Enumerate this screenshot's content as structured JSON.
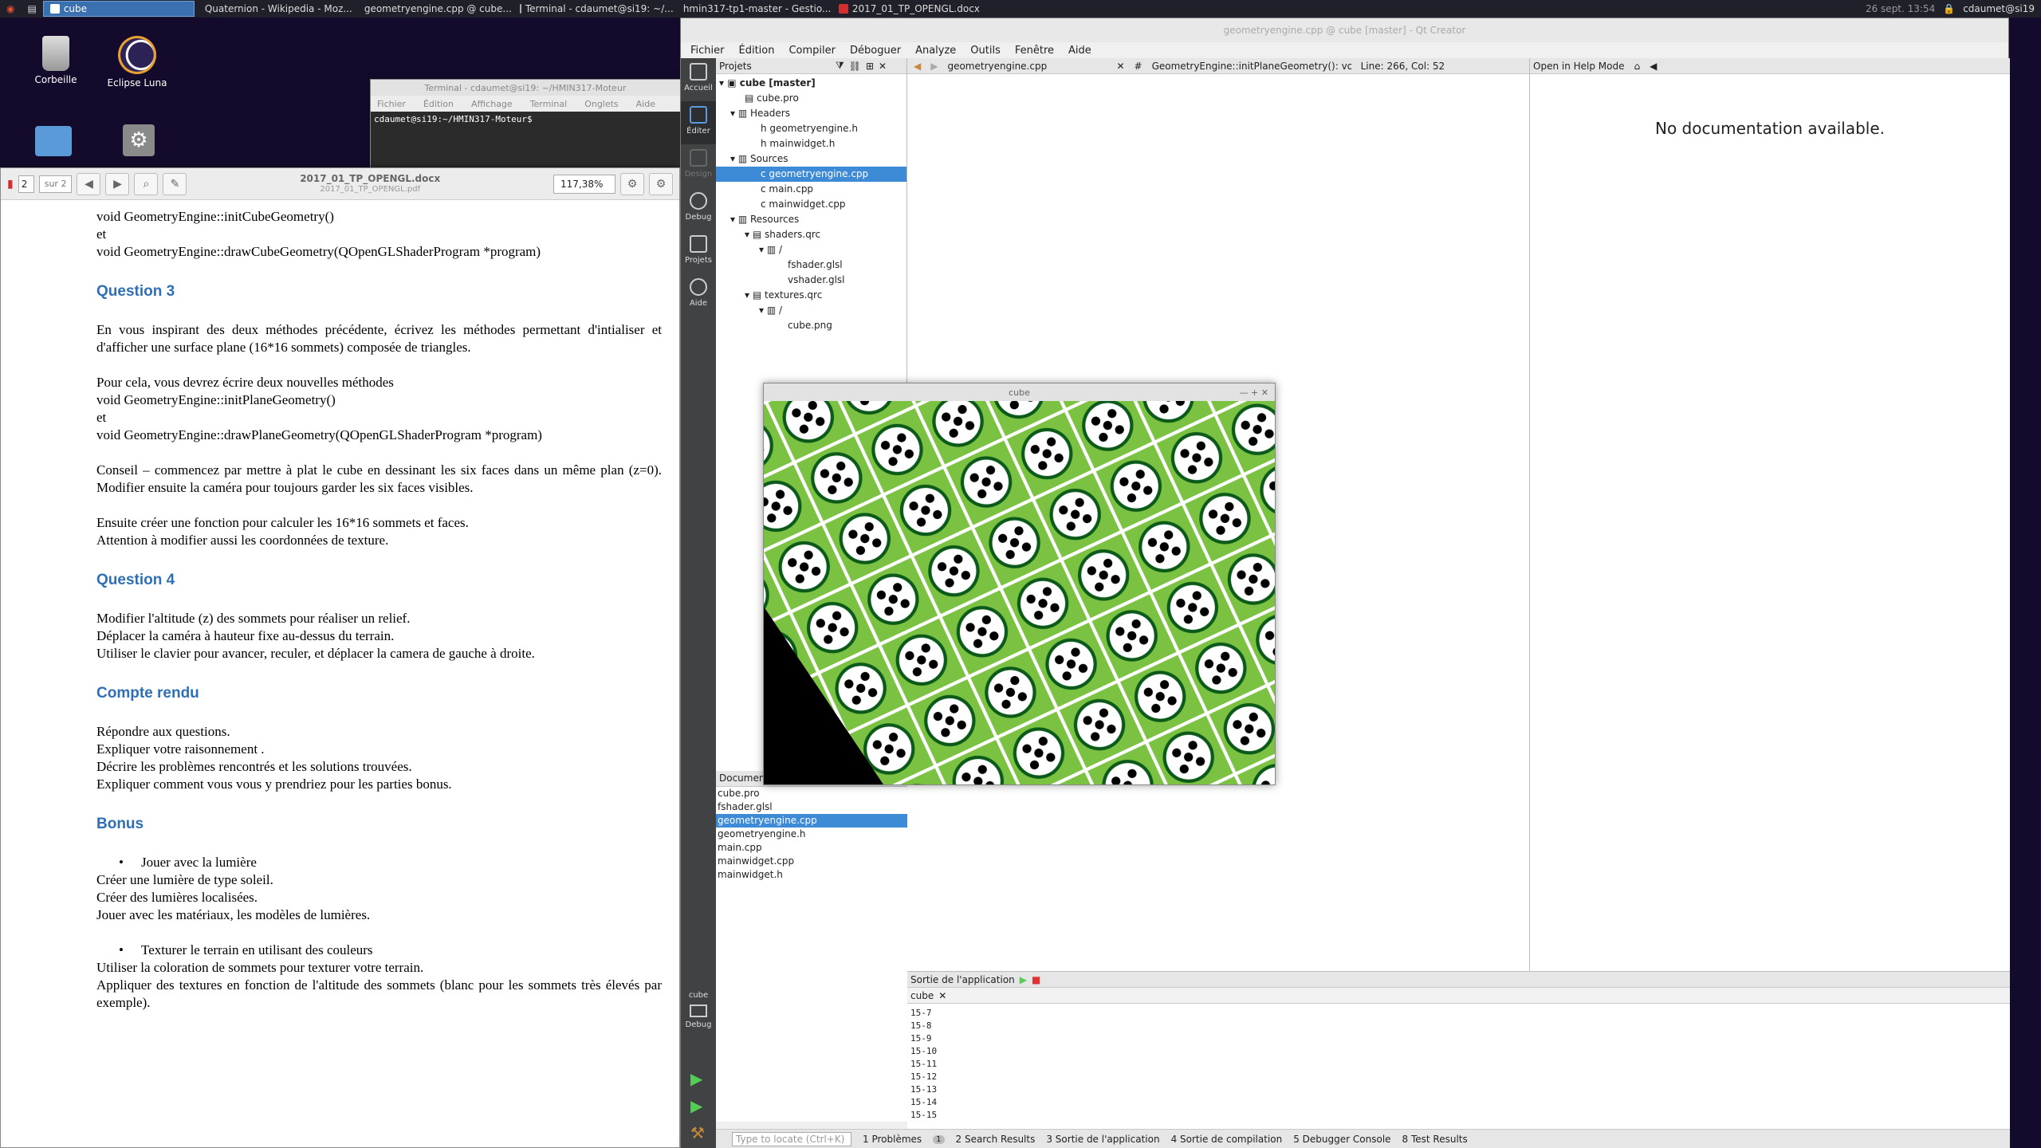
{
  "taskbar": {
    "items": [
      {
        "label": "cube",
        "active": true
      },
      {
        "label": "Quaternion - Wikipedia - Moz..."
      },
      {
        "label": "geometryengine.cpp @ cube..."
      },
      {
        "label": "Terminal - cdaumet@si19: ~/..."
      },
      {
        "label": "hmin317-tp1-master - Gestio..."
      },
      {
        "label": "2017_01_TP_OPENGL.docx"
      }
    ],
    "clock": "26 sept. 13:54",
    "user": "cdaumet@si19"
  },
  "desktop": {
    "icons": [
      {
        "label": "Corbeille"
      },
      {
        "label": "Eclipse Luna"
      }
    ]
  },
  "terminal": {
    "title": "Terminal - cdaumet@si19: ~/HMIN317-Moteur",
    "menu": [
      "Fichier",
      "Édition",
      "Affichage",
      "Terminal",
      "Onglets",
      "Aide"
    ],
    "prompt": "cdaumet@si19:~/HMIN317-Moteur$ "
  },
  "docviewer": {
    "page": "2",
    "of": "sur 2",
    "title": "2017_01_TP_OPENGL.docx",
    "subtitle": "2017_01_TP_OPENGL.pdf",
    "zoom": "117,38%",
    "lines": {
      "l1": "void GeometryEngine::initCubeGeometry()",
      "l2": "et",
      "l3": "void GeometryEngine::drawCubeGeometry(QOpenGLShaderProgram *program)",
      "h3": "Question 3",
      "q3p1": "En vous inspirant des deux méthodes précédente, écrivez les méthodes permettant d'intialiser et d'afficher une surface plane (16*16 sommets) composée de triangles.",
      "q3p2a": "Pour cela, vous devrez écrire deux nouvelles méthodes",
      "q3p2b": "void GeometryEngine::initPlaneGeometry()",
      "q3p2c": "et",
      "q3p2d": "void GeometryEngine::drawPlaneGeometry(QOpenGLShaderProgram *program)",
      "q3p3": "Conseil – commencez par mettre à plat le cube en dessinant les six faces dans un même plan (z=0). Modifier ensuite la caméra pour toujours garder les six faces visibles.",
      "q3p4a": "Ensuite créer une fonction pour calculer les  16*16 sommets et faces.",
      "q3p4b": "Attention à modifier aussi les coordonnées de texture.",
      "h4": "Question 4",
      "q4a": "Modifier l'altitude (z) des sommets pour réaliser un relief.",
      "q4b": "Déplacer la caméra à hauteur fixe au-dessus du terrain.",
      "q4c": "Utiliser le clavier pour avancer, reculer, et déplacer la camera de gauche à droite.",
      "hcr": "Compte rendu",
      "cra": "Répondre aux questions.",
      "crb": "Expliquer votre raisonnement .",
      "crc": "Décrire les problèmes rencontrés et les solutions trouvées.",
      "crd": "Expliquer comment vous vous y prendriez pour les parties bonus.",
      "hb": "Bonus",
      "b1": "Jouer avec la lumière",
      "b1a": "Créer une lumière de type soleil.",
      "b1b": "Créer des lumières localisées.",
      "b1c": "Jouer avec les matériaux, les modèles de lumières.",
      "b2": "Texturer le terrain en utilisant des couleurs",
      "b2a": "Utiliser la coloration de sommets pour texturer votre terrain.",
      "b2b": "Appliquer des textures en fonction de l'altitude des sommets (blanc pour les sommets très élevés par exemple)."
    }
  },
  "qt": {
    "title": "geometryengine.cpp @ cube [master] - Qt Creator",
    "menu": [
      "Fichier",
      "Édition",
      "Compiler",
      "Déboguer",
      "Analyze",
      "Outils",
      "Fenêtre",
      "Aide"
    ],
    "modes": [
      "Accueil",
      "Éditer",
      "Design",
      "Debug",
      "Projets",
      "Aide"
    ],
    "projects_label": "Projets",
    "tree": [
      "cube [master]",
      "cube.pro",
      "Headers",
      "geometryengine.h",
      "mainwidget.h",
      "Sources",
      "geometryengine.cpp",
      "main.cpp",
      "mainwidget.cpp",
      "Resources",
      "shaders.qrc",
      "/",
      "fshader.glsl",
      "vshader.glsl",
      "textures.qrc",
      "/",
      "cube.png"
    ],
    "opendocs_label": "Documents ouverts",
    "opendocs": [
      "cube.pro",
      "fshader.glsl",
      "geometryengine.cpp",
      "geometryengine.h",
      "main.cpp",
      "mainwidget.cpp",
      "mainwidget.h"
    ],
    "editor_file": "geometryengine.cpp",
    "editor_func": "GeometryEngine::initPlaneGeometry(): void",
    "editor_pos": "Line: 266, Col: 52",
    "help_mode": "Open in Help Mode",
    "help_text": "No documentation available.",
    "output_label": "Sortie de l'application",
    "output_tab": "cube",
    "output_lines": "15-7\n15-8\n15-9\n15-10\n15-11\n15-12\n15-13\n15-14\n15-15",
    "kit": "cube",
    "kit_mode": "Debug",
    "locate": "Type to locate (Ctrl+K)",
    "status": [
      "1 Problèmes",
      "2 Search Results",
      "3 Sortie de l'application",
      "4 Sortie de compilation",
      "5 Debugger Console",
      "8 Test Results"
    ],
    "problem_count": "1"
  },
  "cube_window": {
    "title": "cube"
  }
}
